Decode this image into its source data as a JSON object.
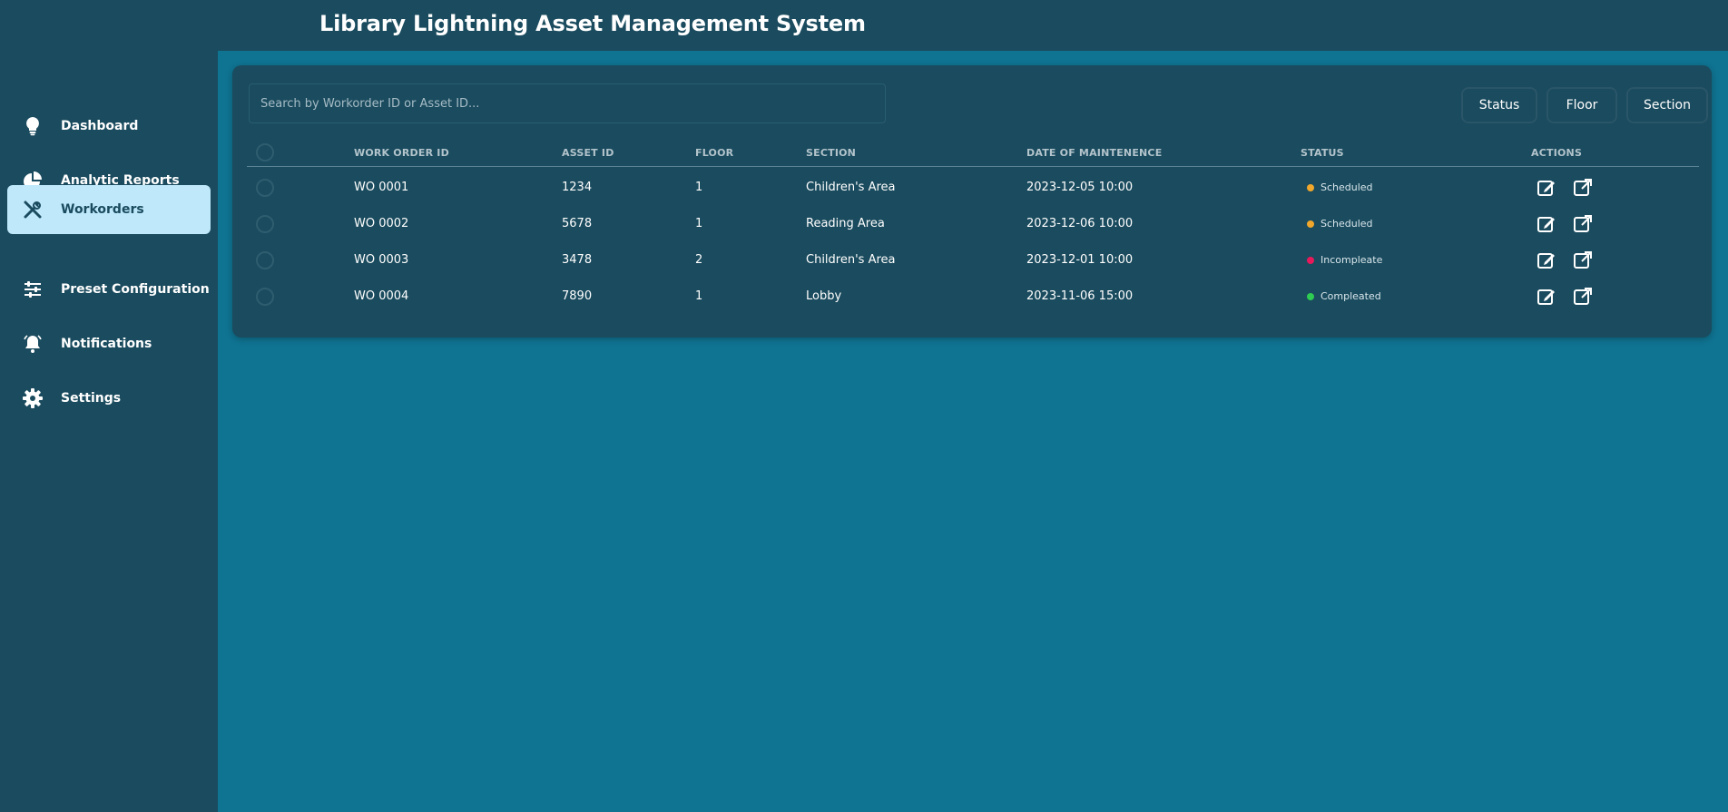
{
  "app": {
    "title": "Library Lightning Asset Management System"
  },
  "sidebar": {
    "items": [
      {
        "label": "Dashboard",
        "icon": "lightbulb-icon"
      },
      {
        "label": "Analytic Reports",
        "icon": "pie-chart-icon"
      },
      {
        "label": "Workorders",
        "icon": "tools-icon",
        "active": true
      },
      {
        "label": "Preset Configuration",
        "icon": "sliders-icon"
      },
      {
        "label": "Notifications",
        "icon": "bell-icon"
      },
      {
        "label": "Settings",
        "icon": "gear-icon"
      }
    ]
  },
  "search": {
    "placeholder": "Search by Workorder ID or Asset ID..."
  },
  "filters": {
    "status": "Status",
    "floor": "Floor",
    "section": "Section"
  },
  "table": {
    "headers": {
      "work_order_id": "WORK ORDER ID",
      "asset_id": "ASSET ID",
      "floor": "FLOOR",
      "section": "SECTION",
      "date": "DATE OF MAINTENENCE",
      "status": "STATUS",
      "actions": "ACTIONS"
    },
    "rows": [
      {
        "work_order_id": "WO 0001",
        "asset_id": "1234",
        "floor": "1",
        "section": "Children's Area",
        "date": "2023-12-05 10:00",
        "status": "Scheduled",
        "status_color": "#f0a72b"
      },
      {
        "work_order_id": "WO 0002",
        "asset_id": "5678",
        "floor": "1",
        "section": "Reading Area",
        "date": "2023-12-06 10:00",
        "status": "Scheduled",
        "status_color": "#f0a72b"
      },
      {
        "work_order_id": "WO 0003",
        "asset_id": "3478",
        "floor": "2",
        "section": "Children's Area",
        "date": "2023-12-01 10:00",
        "status": "Incompleate",
        "status_color": "#e8195a"
      },
      {
        "work_order_id": "WO 0004",
        "asset_id": "7890",
        "floor": "1",
        "section": "Lobby",
        "date": "2023-11-06 15:00",
        "status": "Compleated",
        "status_color": "#2ecc52"
      }
    ]
  },
  "colors": {
    "sidebar_bg": "#1a4b5e",
    "main_bg": "#0f7492",
    "active_nav_bg": "#bfe8fb"
  }
}
